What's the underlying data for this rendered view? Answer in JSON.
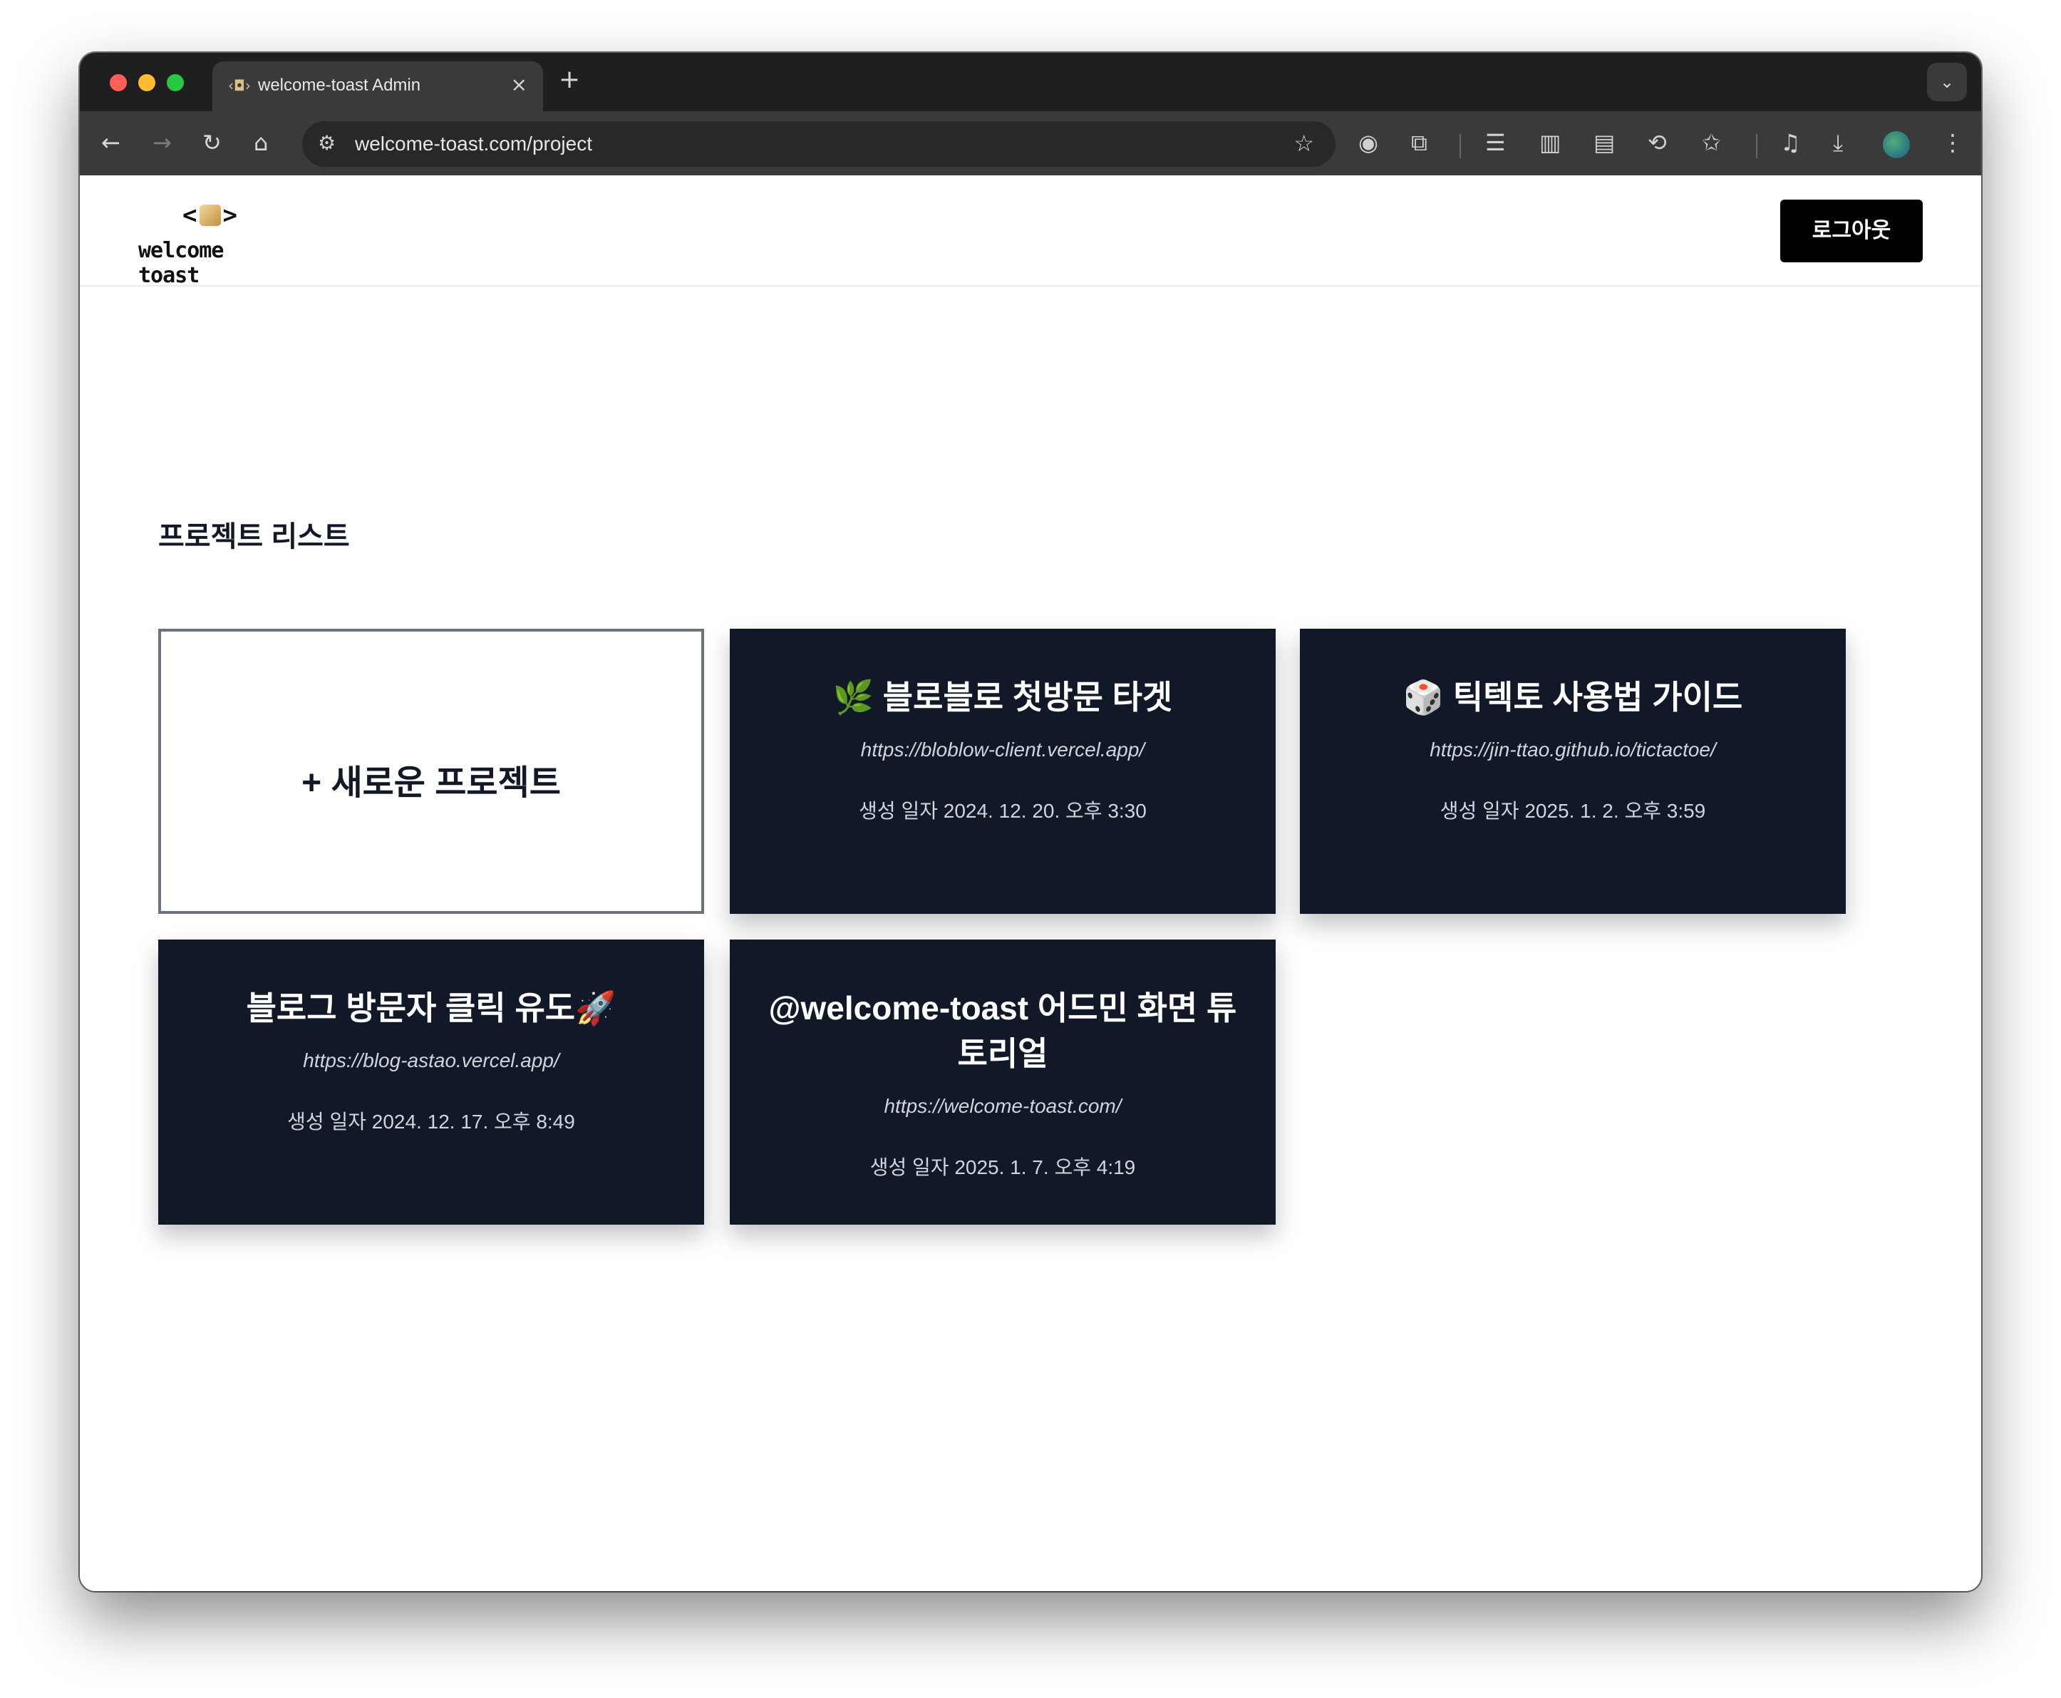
{
  "browser": {
    "tab_title": "welcome-toast Admin",
    "tab_favicon": "‹◘›",
    "url": "welcome-toast.com/project"
  },
  "header": {
    "logo_mark_left": "<",
    "logo_mark_right": ">",
    "logo_text": "welcome toast",
    "logout_label": "로그아웃"
  },
  "main": {
    "section_title": "프로젝트 리스트",
    "new_project_label": "+ 새로운 프로젝트",
    "projects": [
      {
        "title": "🌿 블로블로 첫방문 타겟",
        "url": "https://bloblow-client.vercel.app/",
        "created": "생성 일자 2024. 12. 20. 오후 3:30"
      },
      {
        "title": "🎲 틱텍토 사용법 가이드",
        "url": "https://jin-ttao.github.io/tictactoe/",
        "created": "생성 일자 2025. 1. 2. 오후 3:59"
      },
      {
        "title": "블로그 방문자 클릭 유도🚀",
        "url": "https://blog-astao.vercel.app/",
        "created": "생성 일자 2024. 12. 17. 오후 8:49"
      },
      {
        "title": "@welcome-toast 어드민 화면 튜토리얼",
        "url": "https://welcome-toast.com/",
        "created": "생성 일자 2025. 1. 7. 오후 4:19"
      }
    ]
  },
  "colors": {
    "card_bg": "#111827",
    "logout_bg": "#000000",
    "new_card_border": "#6b7280"
  }
}
